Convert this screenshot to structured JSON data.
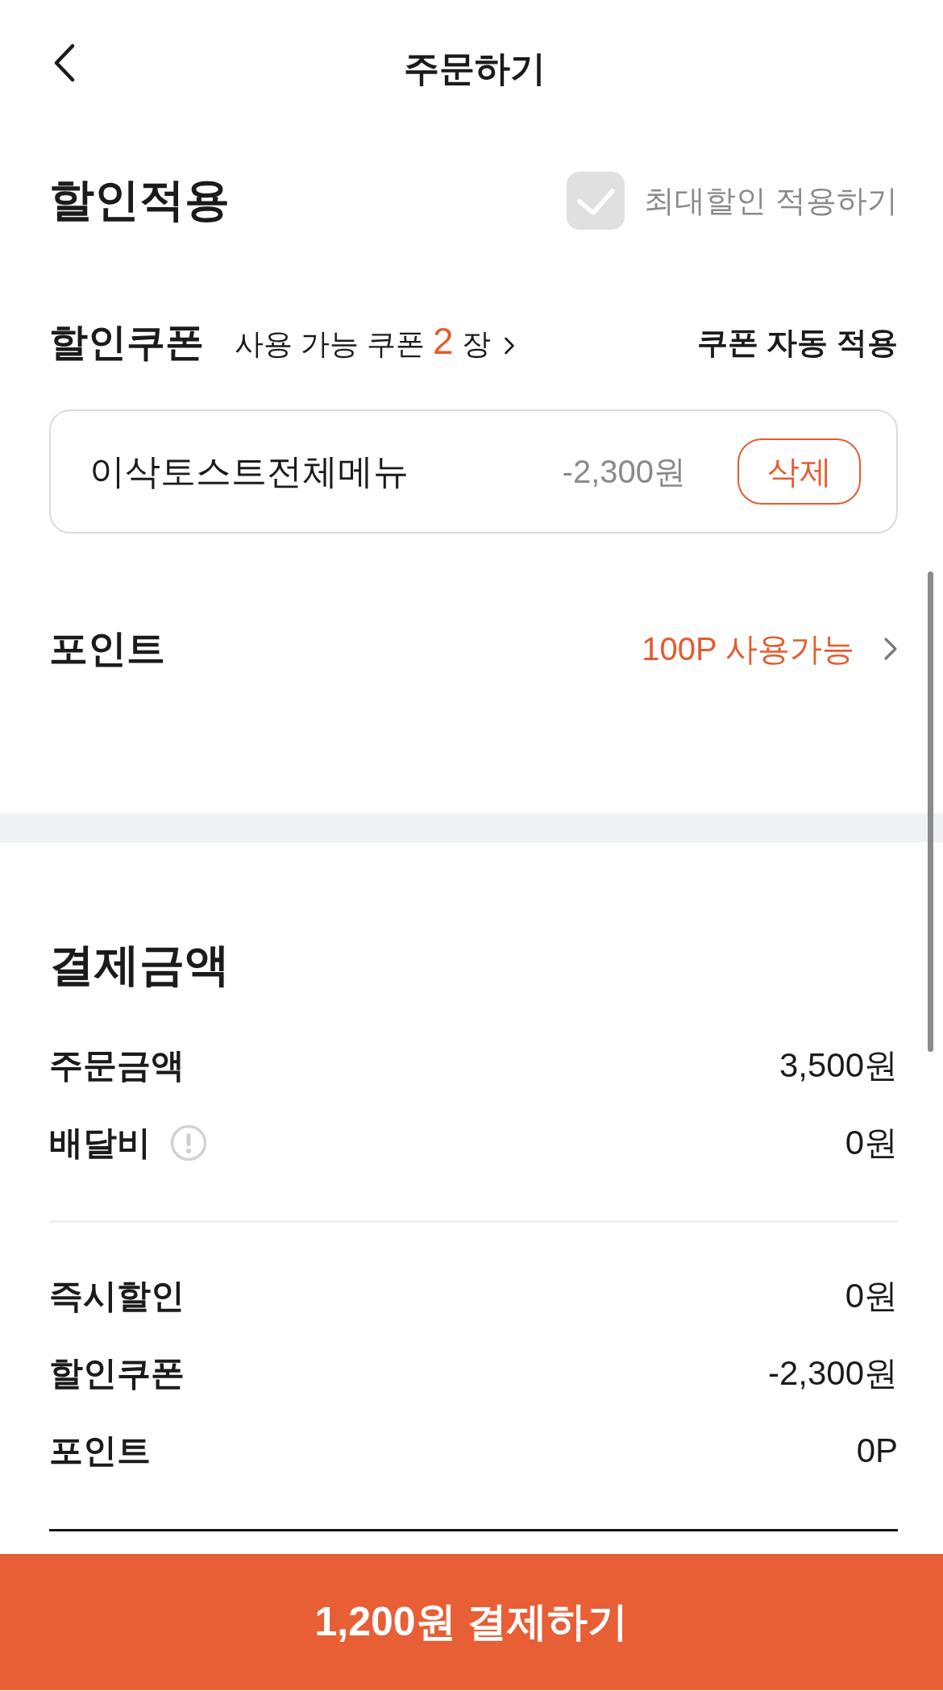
{
  "header": {
    "title": "주문하기"
  },
  "discount": {
    "title": "할인적용",
    "max_discount": {
      "label": "최대할인 적용하기",
      "checked": false
    }
  },
  "coupon": {
    "title": "할인쿠폰",
    "available_prefix": "사용 가능 쿠폰",
    "available_count": "2",
    "available_suffix": "장",
    "auto_apply": "쿠폰 자동 적용",
    "applied": [
      {
        "name": "이삭토스트전체메뉴",
        "amount": "-2,300원",
        "action": "삭제"
      }
    ]
  },
  "points": {
    "title": "포인트",
    "available": "100P 사용가능"
  },
  "payment": {
    "title": "결제금액",
    "summary": [
      {
        "label": "주문금액",
        "value": "3,500원",
        "info": false
      },
      {
        "label": "배달비",
        "value": "0원",
        "info": true
      }
    ],
    "discounts": [
      {
        "label": "즉시할인",
        "value": "0원",
        "info": false
      },
      {
        "label": "할인쿠폰",
        "value": "-2,300원",
        "info": false
      },
      {
        "label": "포인트",
        "value": "0P",
        "info": false
      }
    ]
  },
  "pay_button": {
    "label": "1,200원 결제하기"
  }
}
